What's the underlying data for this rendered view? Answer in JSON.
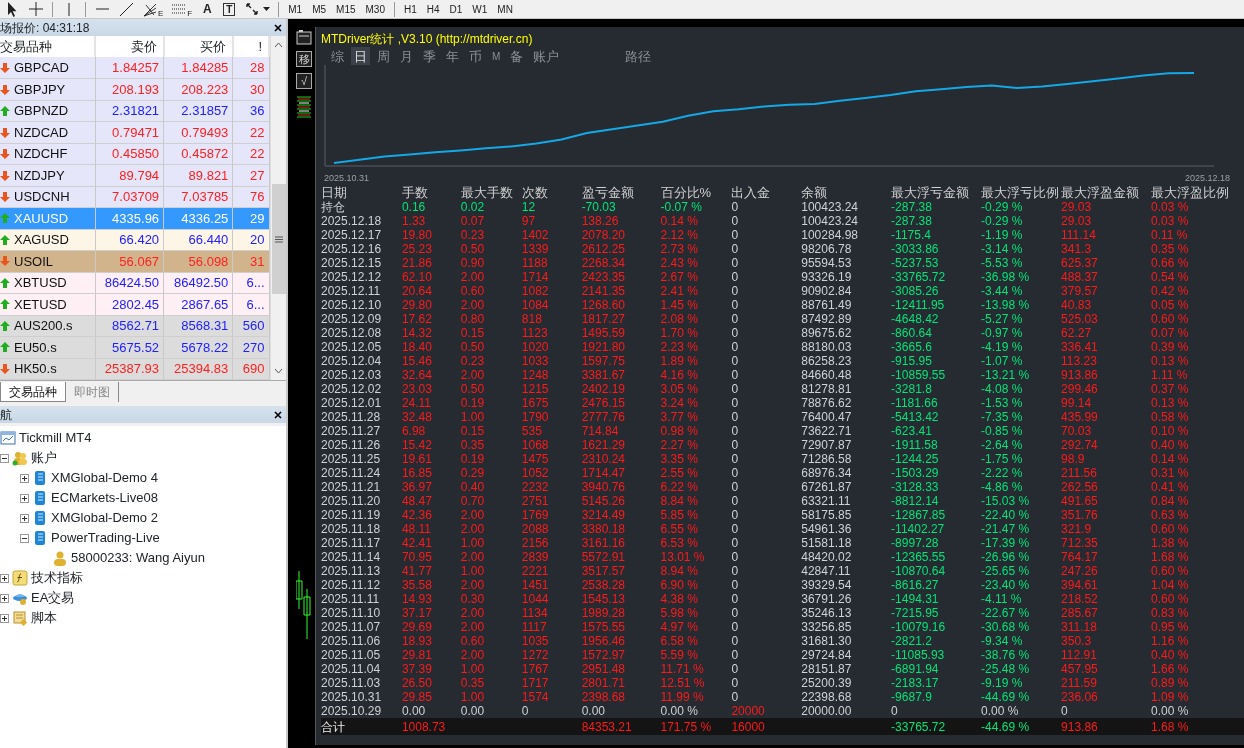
{
  "toolbar": {
    "tools": [
      {
        "kind": "cursor"
      },
      {
        "kind": "crosshair"
      },
      {
        "kind": "vline"
      },
      {
        "kind": "hline"
      },
      {
        "kind": "trendline"
      },
      {
        "kind": "fibo",
        "label": "E"
      },
      {
        "kind": "grid",
        "label": "F"
      },
      {
        "kind": "text",
        "label": "A"
      },
      {
        "kind": "label",
        "label": "T"
      },
      {
        "kind": "arrows"
      }
    ],
    "timeframes": [
      {
        "label": "M1"
      },
      {
        "label": "M5"
      },
      {
        "label": "M15"
      },
      {
        "label": "M30"
      },
      {
        "label": "H1"
      },
      {
        "label": "H4"
      },
      {
        "label": "D1"
      },
      {
        "label": "W1"
      },
      {
        "label": "MN"
      }
    ]
  },
  "market_watch": {
    "title": "场报价: 04:31:18",
    "columns": [
      "交易品种",
      "卖价",
      "买价",
      "!"
    ],
    "rows": [
      {
        "symbol": "GBPCAD",
        "bid": "1.84257",
        "ask": "1.84285",
        "spread": "28",
        "rising": false,
        "color": "#e6e6fa",
        "selected": false
      },
      {
        "symbol": "GBPJPY",
        "bid": "208.193",
        "ask": "208.223",
        "spread": "30",
        "rising": false,
        "color": "#e6e6fa",
        "selected": false
      },
      {
        "symbol": "GBPNZD",
        "bid": "2.31821",
        "ask": "2.31857",
        "spread": "36",
        "rising": true,
        "color": "#e6e6fa",
        "selected": false
      },
      {
        "symbol": "NZDCAD",
        "bid": "0.79471",
        "ask": "0.79493",
        "spread": "22",
        "rising": false,
        "color": "#e6e6fa",
        "selected": false
      },
      {
        "symbol": "NZDCHF",
        "bid": "0.45850",
        "ask": "0.45872",
        "spread": "22",
        "rising": false,
        "color": "#e6e6fa",
        "selected": false
      },
      {
        "symbol": "NZDJPY",
        "bid": "89.794",
        "ask": "89.821",
        "spread": "27",
        "rising": false,
        "color": "#e6e6fa",
        "selected": false
      },
      {
        "symbol": "USDCNH",
        "bid": "7.03709",
        "ask": "7.03785",
        "spread": "76",
        "rising": false,
        "color": "#e6e6fa",
        "selected": false
      },
      {
        "symbol": "XAUUSD",
        "bid": "4335.96",
        "ask": "4336.25",
        "spread": "29",
        "rising": true,
        "selected": true
      },
      {
        "symbol": "XAGUSD",
        "bid": "66.420",
        "ask": "66.440",
        "spread": "20",
        "rising": true,
        "color": "#fdf5e6",
        "selected": false
      },
      {
        "symbol": "USOIL",
        "bid": "56.067",
        "ask": "56.098",
        "spread": "31",
        "rising": false,
        "color": "#d2b48c",
        "selected": false
      },
      {
        "symbol": "XBTUSD",
        "bid": "86424.50",
        "ask": "86492.50",
        "spread": "6...",
        "rising": true,
        "color": "#fff0f5",
        "selected": false
      },
      {
        "symbol": "XETUSD",
        "bid": "2802.45",
        "ask": "2867.65",
        "spread": "6...",
        "rising": true,
        "color": "#fff0f5",
        "selected": false
      },
      {
        "symbol": "AUS200.s",
        "bid": "8562.71",
        "ask": "8568.31",
        "spread": "560",
        "rising": true,
        "color": "#dcdcdc",
        "selected": false
      },
      {
        "symbol": "EU50.s",
        "bid": "5675.52",
        "ask": "5678.22",
        "spread": "270",
        "rising": true,
        "color": "#dcdcdc",
        "selected": false
      },
      {
        "symbol": "HK50.s",
        "bid": "25387.93",
        "ask": "25394.83",
        "spread": "690",
        "rising": false,
        "color": "#dcdcdc",
        "selected": false
      }
    ],
    "tabs": [
      {
        "label": "交易品种",
        "selected": true
      },
      {
        "label": "即时图",
        "selected": false
      }
    ]
  },
  "navigator": {
    "title": "航",
    "tree": [
      {
        "label": "Tickmill MT4",
        "kind": "terminal"
      },
      {
        "label": "账户",
        "kind": "accounts",
        "expanded": true,
        "children": [
          {
            "label": "XMGlobal-Demo 4",
            "kind": "server",
            "expanded": false
          },
          {
            "label": "ECMarkets-Live08",
            "kind": "server",
            "expanded": false
          },
          {
            "label": "XMGlobal-Demo 2",
            "kind": "server",
            "expanded": false
          },
          {
            "label": "PowerTrading-Live",
            "kind": "server",
            "expanded": true,
            "children": [
              {
                "label": "58000233: Wang Aiyun",
                "kind": "user"
              }
            ]
          }
        ]
      },
      {
        "label": "技术指标",
        "kind": "indicators",
        "expanded": false
      },
      {
        "label": "EA交易",
        "kind": "experts",
        "expanded": false
      },
      {
        "label": "脚本",
        "kind": "scripts",
        "expanded": false
      }
    ]
  },
  "stats_window": {
    "title": "MTDriver统计 ,V3.10 (http://mtdriver.cn)",
    "side_buttons": [
      {
        "kind": "icon"
      },
      {
        "kind": "text",
        "label": "移"
      },
      {
        "kind": "text",
        "label": "√"
      }
    ],
    "tabs": [
      {
        "label": "综",
        "selected": false
      },
      {
        "label": "日",
        "selected": true
      },
      {
        "label": "周",
        "selected": false
      },
      {
        "label": "月",
        "selected": false
      },
      {
        "label": "季",
        "selected": false
      },
      {
        "label": "年",
        "selected": false
      },
      {
        "label": "币",
        "selected": false
      },
      {
        "label": "M",
        "selected": false
      },
      {
        "label": "备",
        "selected": false
      },
      {
        "label": "账户",
        "selected": false
      },
      {
        "label": "路径",
        "selected": false
      }
    ],
    "chart": {
      "start_label": "2025.10.31",
      "end_label": "2025.12.18"
    },
    "table": {
      "columns": [
        "日期",
        "手数",
        "最大手数",
        "次数",
        "盈亏金额",
        "百分比%",
        "出入金",
        "余额",
        "最大浮亏金额",
        "最大浮亏比例",
        "最大浮盈金额",
        "最大浮盈比例"
      ],
      "rows": [
        {
          "kind": "position",
          "cells": [
            "持仓",
            "0.16",
            "0.02",
            "12",
            "-70.03",
            "-0.07 %",
            "0",
            "100423.24",
            "-287.38",
            "-0.29 %",
            "29.03",
            "0.03 %"
          ]
        },
        {
          "kind": "day",
          "cells": [
            "2025.12.18",
            "1.33",
            "0.07",
            "97",
            "138.26",
            "0.14 %",
            "0",
            "100423.24",
            "-287.38",
            "-0.29 %",
            "29.03",
            "0.03 %"
          ]
        },
        {
          "kind": "day",
          "cells": [
            "2025.12.17",
            "19.80",
            "0.23",
            "1402",
            "2078.20",
            "2.12 %",
            "0",
            "100284.98",
            "-1175.4",
            "-1.19 %",
            "111.14",
            "0.11 %"
          ]
        },
        {
          "kind": "day",
          "cells": [
            "2025.12.16",
            "25.23",
            "0.50",
            "1339",
            "2612.25",
            "2.73 %",
            "0",
            "98206.78",
            "-3033.86",
            "-3.14 %",
            "341.3",
            "0.35 %"
          ]
        },
        {
          "kind": "day",
          "cells": [
            "2025.12.15",
            "21.86",
            "0.90",
            "1188",
            "2268.34",
            "2.43 %",
            "0",
            "95594.53",
            "-5237.53",
            "-5.53 %",
            "625.37",
            "0.66 %"
          ]
        },
        {
          "kind": "day",
          "cells": [
            "2025.12.12",
            "62.10",
            "2.00",
            "1714",
            "2423.35",
            "2.67 %",
            "0",
            "93326.19",
            "-33765.72",
            "-36.98 %",
            "488.37",
            "0.54 %"
          ]
        },
        {
          "kind": "day",
          "cells": [
            "2025.12.11",
            "20.64",
            "0.60",
            "1082",
            "2141.35",
            "2.41 %",
            "0",
            "90902.84",
            "-3085.26",
            "-3.44 %",
            "379.57",
            "0.42 %"
          ]
        },
        {
          "kind": "day",
          "cells": [
            "2025.12.10",
            "29.80",
            "2.00",
            "1084",
            "1268.60",
            "1.45 %",
            "0",
            "88761.49",
            "-12411.95",
            "-13.98 %",
            "40.83",
            "0.05 %"
          ]
        },
        {
          "kind": "day",
          "cells": [
            "2025.12.09",
            "17.62",
            "0.80",
            "818",
            "1817.27",
            "2.08 %",
            "0",
            "87492.89",
            "-4648.42",
            "-5.27 %",
            "525.03",
            "0.60 %"
          ]
        },
        {
          "kind": "day",
          "cells": [
            "2025.12.08",
            "14.32",
            "0.15",
            "1123",
            "1495.59",
            "1.70 %",
            "0",
            "89675.62",
            "-860.64",
            "-0.97 %",
            "62.27",
            "0.07 %"
          ]
        },
        {
          "kind": "day",
          "cells": [
            "2025.12.05",
            "18.40",
            "0.50",
            "1020",
            "1921.80",
            "2.23 %",
            "0",
            "88180.03",
            "-3665.6",
            "-4.19 %",
            "336.41",
            "0.39 %"
          ]
        },
        {
          "kind": "day",
          "cells": [
            "2025.12.04",
            "15.46",
            "0.23",
            "1033",
            "1597.75",
            "1.89 %",
            "0",
            "86258.23",
            "-915.95",
            "-1.07 %",
            "113.23",
            "0.13 %"
          ]
        },
        {
          "kind": "day",
          "cells": [
            "2025.12.03",
            "32.64",
            "2.00",
            "1248",
            "3381.67",
            "4.16 %",
            "0",
            "84660.48",
            "-10859.55",
            "-13.21 %",
            "913.86",
            "1.11 %"
          ]
        },
        {
          "kind": "day",
          "cells": [
            "2025.12.02",
            "23.03",
            "0.50",
            "1215",
            "2402.19",
            "3.05 %",
            "0",
            "81278.81",
            "-3281.8",
            "-4.08 %",
            "299.46",
            "0.37 %"
          ]
        },
        {
          "kind": "day",
          "cells": [
            "2025.12.01",
            "24.11",
            "0.19",
            "1675",
            "2476.15",
            "3.24 %",
            "0",
            "78876.62",
            "-1181.66",
            "-1.53 %",
            "99.14",
            "0.13 %"
          ]
        },
        {
          "kind": "day",
          "cells": [
            "2025.11.28",
            "32.48",
            "1.00",
            "1790",
            "2777.76",
            "3.77 %",
            "0",
            "76400.47",
            "-5413.42",
            "-7.35 %",
            "435.99",
            "0.58 %"
          ]
        },
        {
          "kind": "day",
          "cells": [
            "2025.11.27",
            "6.98",
            "0.15",
            "535",
            "714.84",
            "0.98 %",
            "0",
            "73622.71",
            "-623.41",
            "-0.85 %",
            "70.03",
            "0.10 %"
          ]
        },
        {
          "kind": "day",
          "cells": [
            "2025.11.26",
            "15.42",
            "0.35",
            "1068",
            "1621.29",
            "2.27 %",
            "0",
            "72907.87",
            "-1911.58",
            "-2.64 %",
            "292.74",
            "0.40 %"
          ]
        },
        {
          "kind": "day",
          "cells": [
            "2025.11.25",
            "19.61",
            "0.19",
            "1475",
            "2310.24",
            "3.35 %",
            "0",
            "71286.58",
            "-1244.25",
            "-1.75 %",
            "98.9",
            "0.14 %"
          ]
        },
        {
          "kind": "day",
          "cells": [
            "2025.11.24",
            "16.85",
            "0.29",
            "1052",
            "1714.47",
            "2.55 %",
            "0",
            "68976.34",
            "-1503.29",
            "-2.22 %",
            "211.56",
            "0.31 %"
          ]
        },
        {
          "kind": "day",
          "cells": [
            "2025.11.21",
            "36.97",
            "0.40",
            "2232",
            "3940.76",
            "6.22 %",
            "0",
            "67261.87",
            "-3128.33",
            "-4.86 %",
            "262.56",
            "0.41 %"
          ]
        },
        {
          "kind": "day",
          "cells": [
            "2025.11.20",
            "48.47",
            "0.70",
            "2751",
            "5145.26",
            "8.84 %",
            "0",
            "63321.11",
            "-8812.14",
            "-15.03 %",
            "491.65",
            "0.84 %"
          ]
        },
        {
          "kind": "day",
          "cells": [
            "2025.11.19",
            "42.36",
            "2.00",
            "1769",
            "3214.49",
            "5.85 %",
            "0",
            "58175.85",
            "-12867.85",
            "-22.40 %",
            "351.76",
            "0.63 %"
          ]
        },
        {
          "kind": "day",
          "cells": [
            "2025.11.18",
            "48.11",
            "2.00",
            "2088",
            "3380.18",
            "6.55 %",
            "0",
            "54961.36",
            "-11402.27",
            "-21.47 %",
            "321.9",
            "0.60 %"
          ]
        },
        {
          "kind": "day",
          "cells": [
            "2025.11.17",
            "42.41",
            "1.00",
            "2156",
            "3161.16",
            "6.53 %",
            "0",
            "51581.18",
            "-8997.28",
            "-17.39 %",
            "712.35",
            "1.38 %"
          ]
        },
        {
          "kind": "day",
          "cells": [
            "2025.11.14",
            "70.95",
            "2.00",
            "2839",
            "5572.91",
            "13.01 %",
            "0",
            "48420.02",
            "-12365.55",
            "-26.96 %",
            "764.17",
            "1.68 %"
          ]
        },
        {
          "kind": "day",
          "cells": [
            "2025.11.13",
            "41.77",
            "1.00",
            "2221",
            "3517.57",
            "8.94 %",
            "0",
            "42847.11",
            "-10870.64",
            "-25.65 %",
            "247.26",
            "0.60 %"
          ]
        },
        {
          "kind": "day",
          "cells": [
            "2025.11.12",
            "35.58",
            "2.00",
            "1451",
            "2538.28",
            "6.90 %",
            "0",
            "39329.54",
            "-8616.27",
            "-23.40 %",
            "394.61",
            "1.04 %"
          ]
        },
        {
          "kind": "day",
          "cells": [
            "2025.11.11",
            "14.93",
            "0.30",
            "1044",
            "1545.13",
            "4.38 %",
            "0",
            "36791.26",
            "-1494.31",
            "-4.11 %",
            "218.52",
            "0.60 %"
          ]
        },
        {
          "kind": "day",
          "cells": [
            "2025.11.10",
            "37.17",
            "2.00",
            "1134",
            "1989.28",
            "5.98 %",
            "0",
            "35246.13",
            "-7215.95",
            "-22.67 %",
            "285.67",
            "0.83 %"
          ]
        },
        {
          "kind": "day",
          "cells": [
            "2025.11.07",
            "29.69",
            "2.00",
            "1117",
            "1575.55",
            "4.97 %",
            "0",
            "33256.85",
            "-10079.16",
            "-30.68 %",
            "311.18",
            "0.95 %"
          ]
        },
        {
          "kind": "day",
          "cells": [
            "2025.11.06",
            "18.93",
            "0.60",
            "1035",
            "1956.46",
            "6.58 %",
            "0",
            "31681.30",
            "-2821.2",
            "-9.34 %",
            "350.3",
            "1.16 %"
          ]
        },
        {
          "kind": "day",
          "cells": [
            "2025.11.05",
            "29.81",
            "2.00",
            "1272",
            "1572.97",
            "5.59 %",
            "0",
            "29724.84",
            "-11085.93",
            "-38.76 %",
            "112.91",
            "0.40 %"
          ]
        },
        {
          "kind": "day",
          "cells": [
            "2025.11.04",
            "37.39",
            "1.00",
            "1767",
            "2951.48",
            "11.71 %",
            "0",
            "28151.87",
            "-6891.94",
            "-25.48 %",
            "457.95",
            "1.66 %"
          ]
        },
        {
          "kind": "day",
          "cells": [
            "2025.11.03",
            "26.50",
            "0.35",
            "1717",
            "2801.71",
            "12.51 %",
            "0",
            "25200.39",
            "-2183.17",
            "-9.19 %",
            "211.59",
            "0.89 %"
          ]
        },
        {
          "kind": "day",
          "cells": [
            "2025.10.31",
            "29.85",
            "1.00",
            "1574",
            "2398.68",
            "11.99 %",
            "0",
            "22398.68",
            "-9687.9",
            "-44.69 %",
            "236.06",
            "1.09 %"
          ]
        },
        {
          "kind": "initial",
          "cells": [
            "2025.10.29",
            "0.00",
            "0.00",
            "0",
            "0.00",
            "0.00 %",
            "20000",
            "20000.00",
            "0",
            "0.00 %",
            "0",
            "0.00 %"
          ]
        }
      ],
      "total": {
        "label": "合计",
        "lots": "1008.73",
        "pnl": "84353.21",
        "percent": "171.75 %",
        "deposit": "16000",
        "max_float_loss": "-33765.72",
        "max_float_loss_pct": "-44.69 %",
        "max_float_profit": "913.86",
        "max_float_profit_pct": "1.68 %"
      }
    }
  }
}
